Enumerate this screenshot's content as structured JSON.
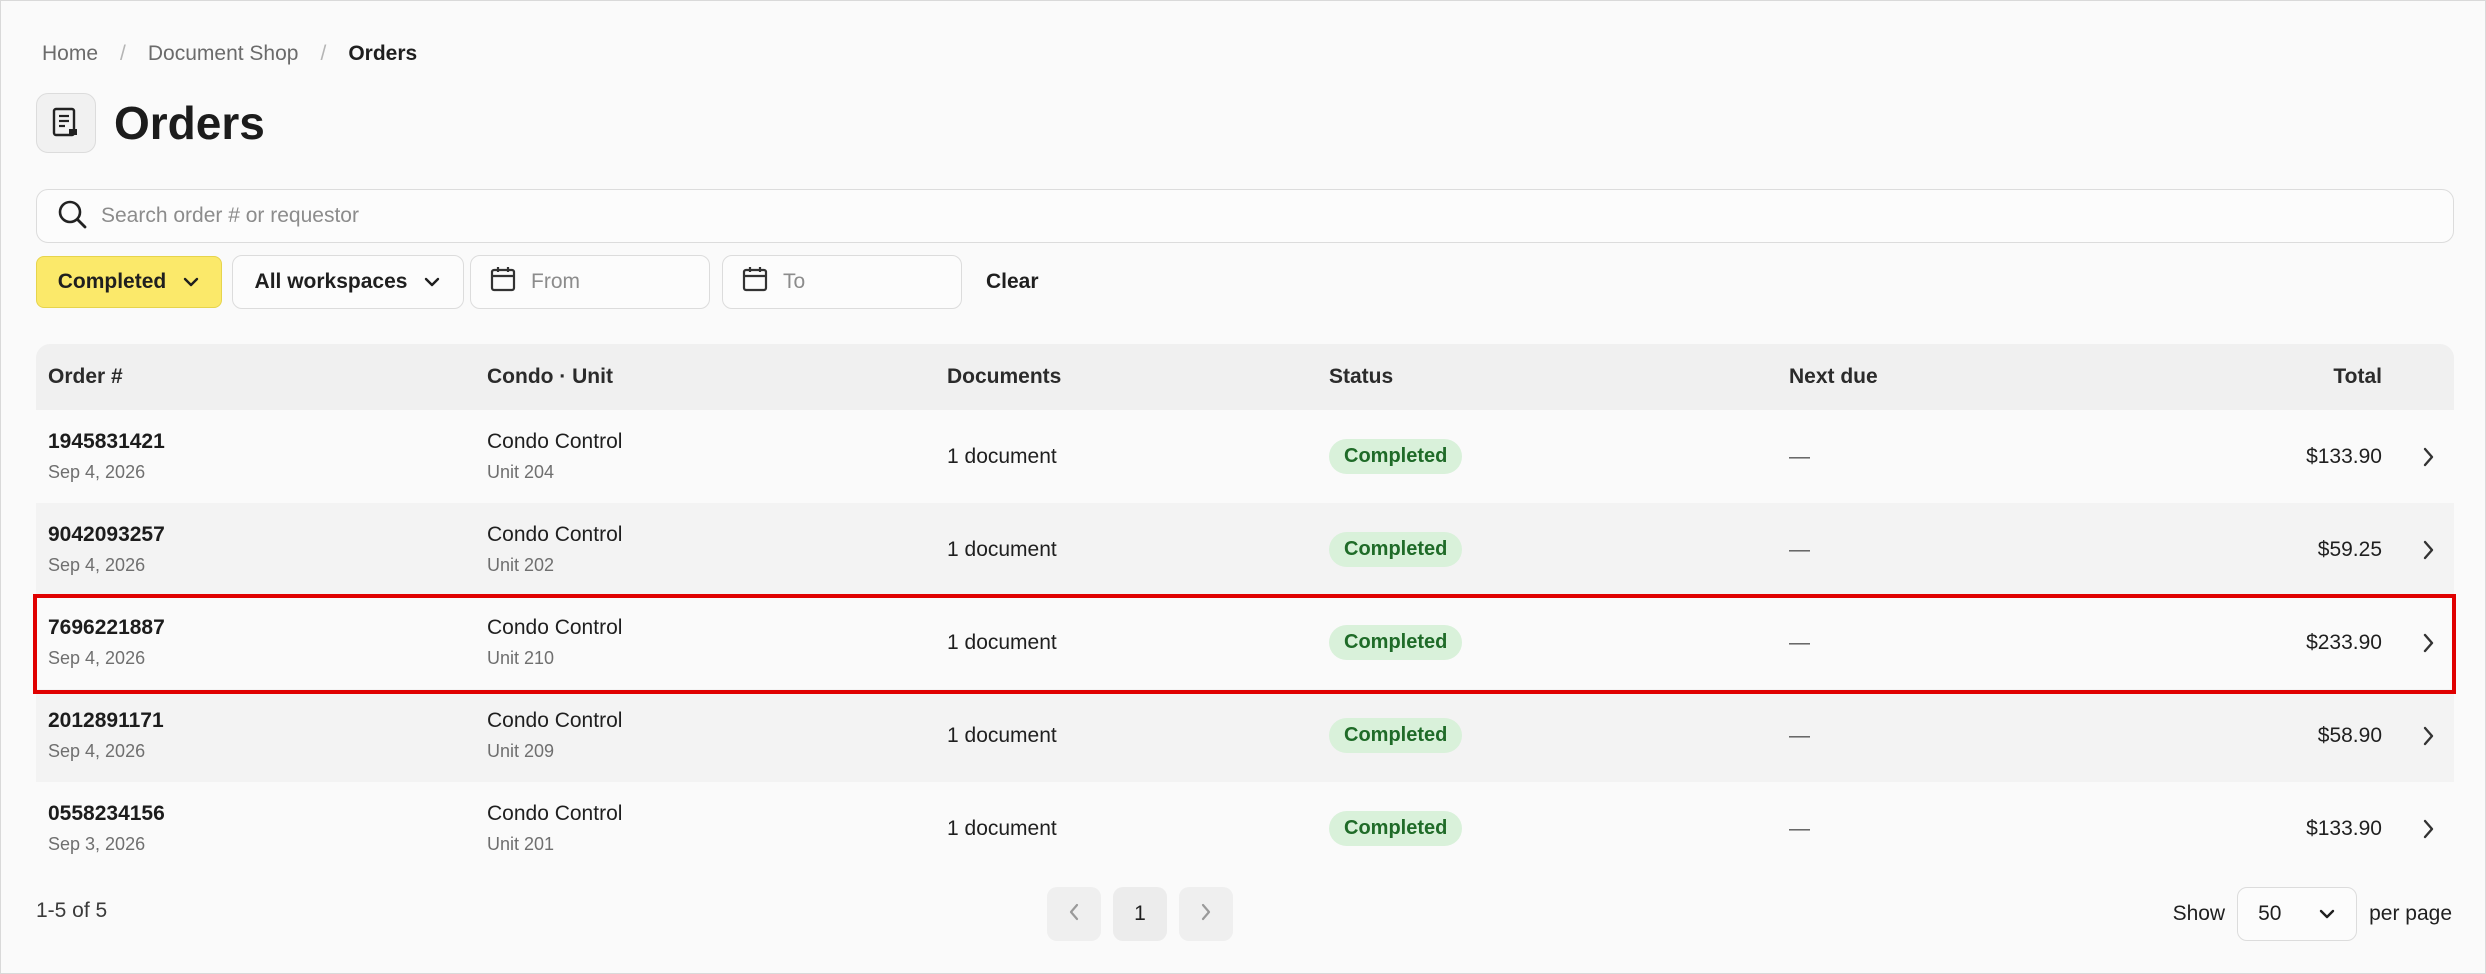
{
  "breadcrumb": [
    "Home",
    "Document Shop",
    "Orders"
  ],
  "page": {
    "title": "Orders",
    "icon": "document-icon"
  },
  "search": {
    "placeholder": "Search order # or requestor",
    "value": ""
  },
  "filters": {
    "status": "Completed",
    "workspace": "All workspaces",
    "from_placeholder": "From",
    "to_placeholder": "To",
    "clear_label": "Clear",
    "colors": {
      "status_active_bg": "#fbe96a"
    }
  },
  "table": {
    "columns": {
      "order": "Order #",
      "condo": "Condo · Unit",
      "documents": "Documents",
      "status": "Status",
      "next_due": "Next due",
      "total": "Total"
    },
    "rows": [
      {
        "order": "1945831421",
        "date": "Sep 4, 2026",
        "condo": "Condo Control",
        "unit": "Unit 204",
        "documents": "1 document",
        "status": "Completed",
        "next_due": "—",
        "total": "$133.90"
      },
      {
        "order": "9042093257",
        "date": "Sep 4, 2026",
        "condo": "Condo Control",
        "unit": "Unit 202",
        "documents": "1 document",
        "status": "Completed",
        "next_due": "—",
        "total": "$59.25"
      },
      {
        "order": "7696221887",
        "date": "Sep 4, 2026",
        "condo": "Condo Control",
        "unit": "Unit 210",
        "documents": "1 document",
        "status": "Completed",
        "next_due": "—",
        "total": "$233.90"
      },
      {
        "order": "2012891171",
        "date": "Sep 4, 2026",
        "condo": "Condo Control",
        "unit": "Unit 209",
        "documents": "1 document",
        "status": "Completed",
        "next_due": "—",
        "total": "$58.90"
      },
      {
        "order": "0558234156",
        "date": "Sep 3, 2026",
        "condo": "Condo Control",
        "unit": "Unit 201",
        "documents": "1 document",
        "status": "Completed",
        "next_due": "—",
        "total": "$133.90"
      }
    ],
    "status_colors": {
      "badge_bg": "#d9f1da",
      "badge_text": "#1f6b28"
    },
    "highlight_color": "#e00000"
  },
  "pagination": {
    "summary": "1-5 of 5",
    "current_page": "1",
    "show_label": "Show",
    "per_page_value": "50",
    "per_page_label": "per page"
  }
}
